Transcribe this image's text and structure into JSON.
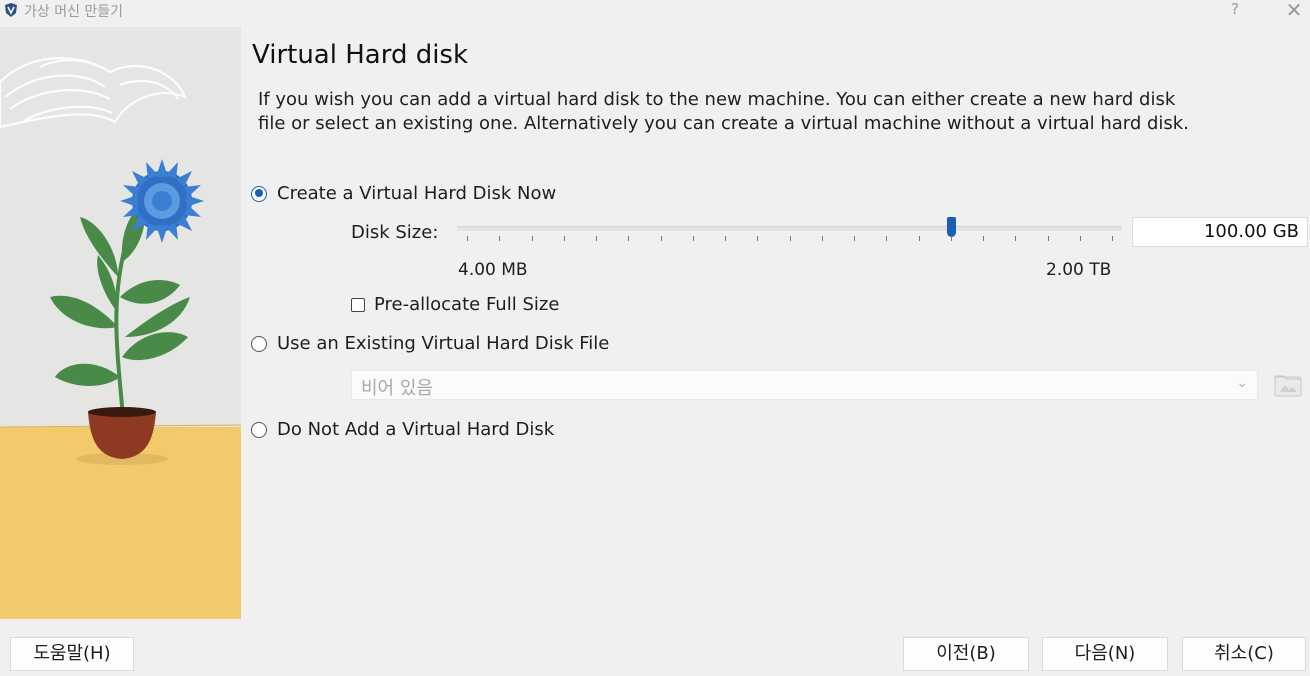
{
  "window": {
    "title": "가상 머신 만들기",
    "help": "?",
    "close": "✕"
  },
  "heading": "Virtual Hard disk",
  "description": "If you wish you can add a virtual hard disk to the new machine. You can either create a new hard disk file or select an existing one. Alternatively you can create a virtual machine without a virtual hard disk.",
  "options": {
    "create_now": {
      "label": "Create a Virtual Hard Disk Now",
      "selected": true
    },
    "use_existing": {
      "label": "Use an Existing Virtual Hard Disk File",
      "selected": false
    },
    "do_not_add": {
      "label": "Do Not Add a Virtual Hard Disk",
      "selected": false
    }
  },
  "disk": {
    "size_label": "Disk Size:",
    "value": "100.00 GB",
    "slider_fraction": 0.75,
    "min_label": "4.00 MB",
    "max_label": "2.00 TB",
    "preallocate_label": "Pre-allocate Full Size",
    "preallocate_checked": false
  },
  "existing_file": {
    "value": "비어 있음"
  },
  "icons": {
    "app": "virtualbox-logo-icon",
    "dropdown": "chevron-down-icon",
    "folder": "folder-browse-icon"
  },
  "colors": {
    "accent": "#1a5fb4",
    "floor": "#f1ca6c",
    "flower": "#3b7fd4",
    "leaf": "#4a8a48",
    "pot": "#8e3a23"
  },
  "buttons": {
    "help": "도움말(H)",
    "back": "이전(B)",
    "next": "다음(N)",
    "cancel": "취소(C)"
  }
}
